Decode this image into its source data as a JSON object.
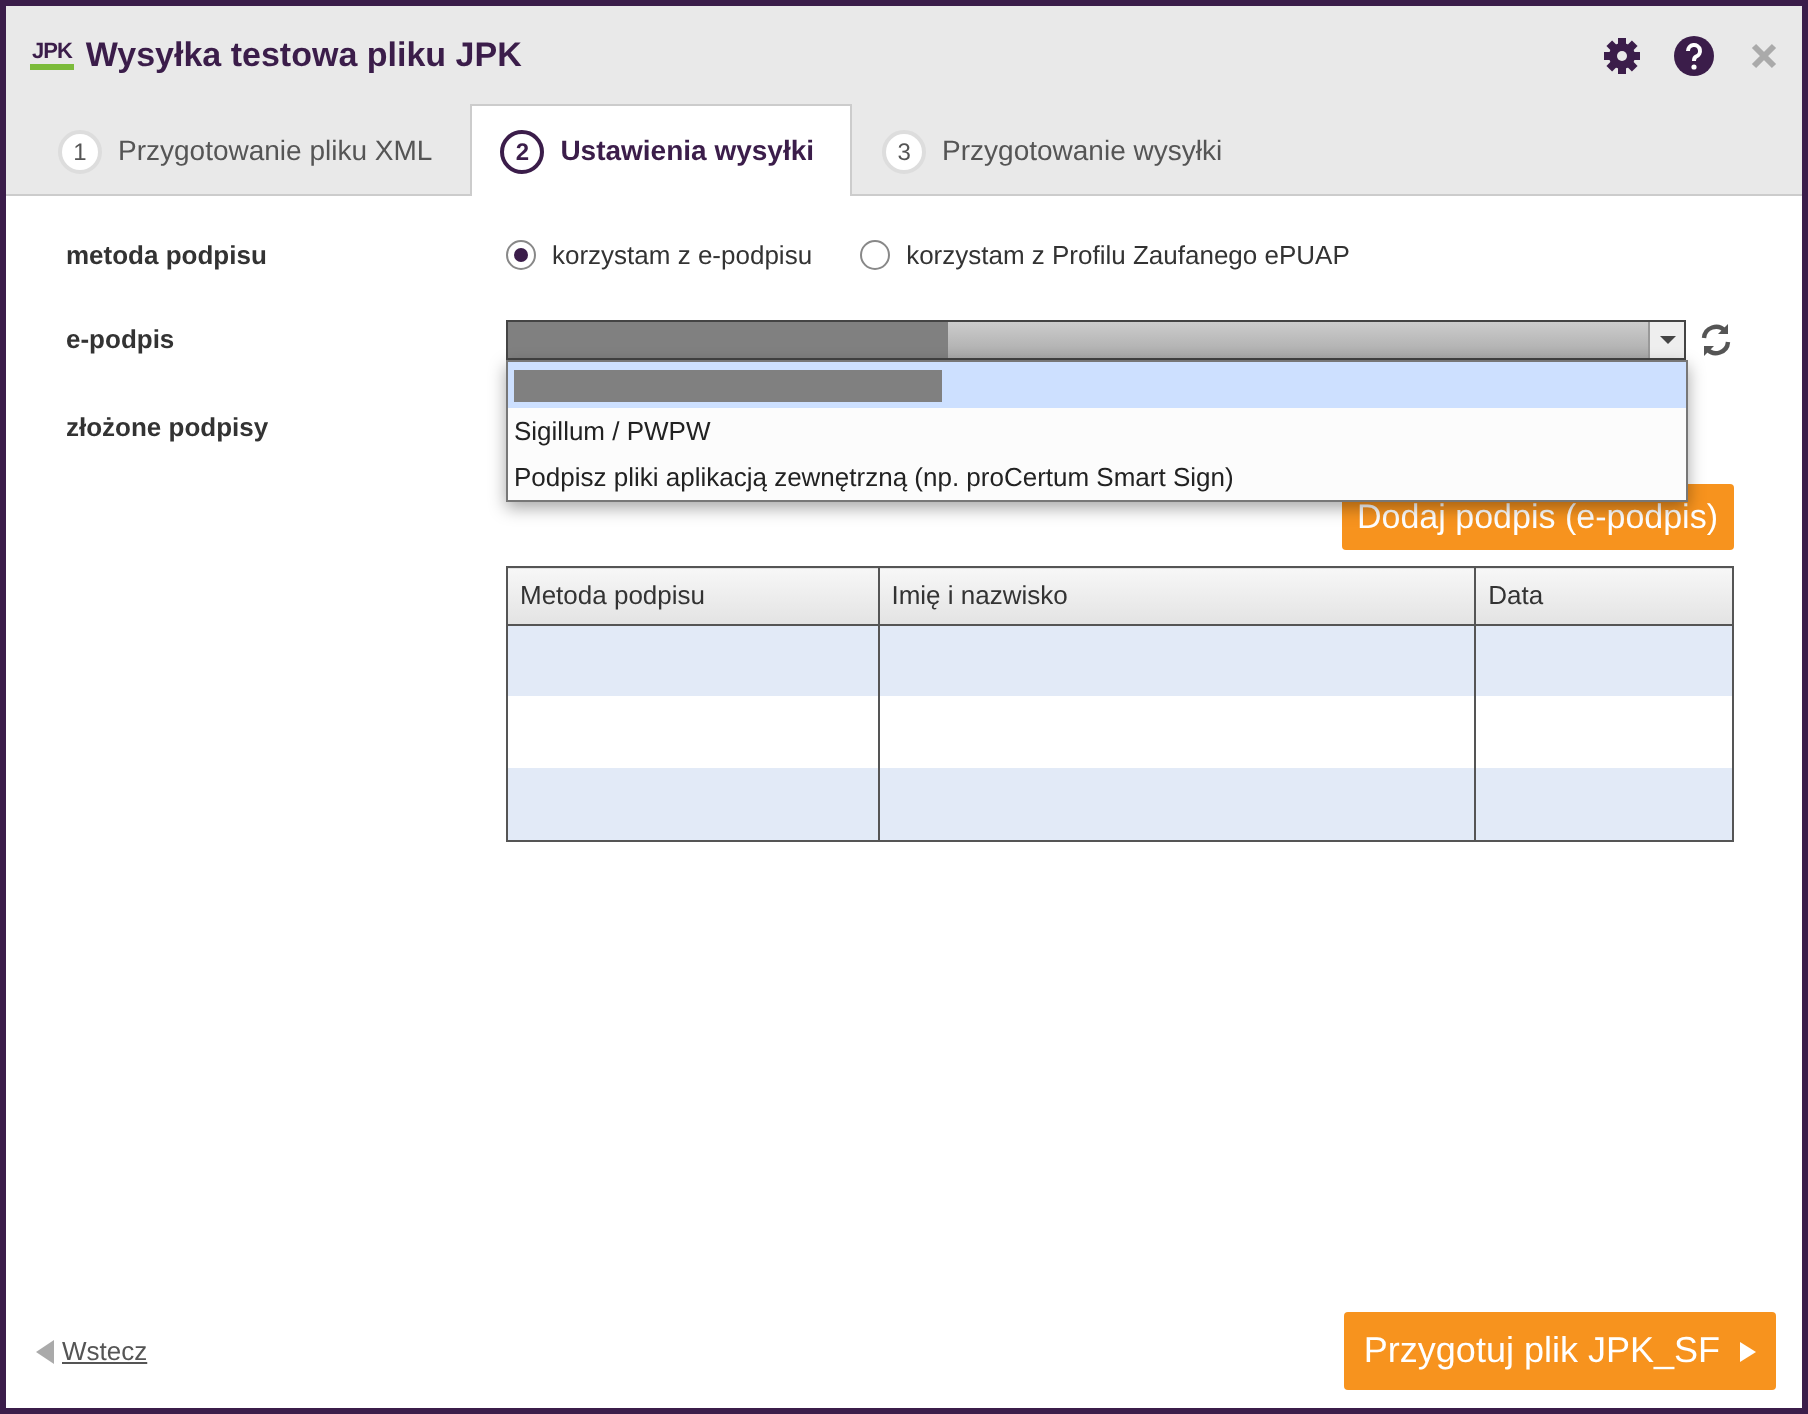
{
  "window": {
    "title": "Wysyłka testowa pliku JPK",
    "logo": "JPK"
  },
  "tabs": [
    {
      "number": "1",
      "label": "Przygotowanie pliku XML",
      "selected": false
    },
    {
      "number": "2",
      "label": "Ustawienia wysyłki",
      "selected": true
    },
    {
      "number": "3",
      "label": "Przygotowanie wysyłki",
      "selected": false
    }
  ],
  "form": {
    "signature_method": {
      "label": "metoda podpisu",
      "options": [
        {
          "label": "korzystam z e-podpisu",
          "selected": true
        },
        {
          "label": "korzystam z Profilu Zaufanego ePUAP",
          "selected": false
        }
      ]
    },
    "e_signature": {
      "label": "e-podpis",
      "value": {
        "kind": "redacted"
      },
      "expanded": true,
      "options": [
        {
          "kind": "redacted",
          "selected": true
        },
        {
          "kind": "text",
          "label": "Sigillum / PWPW",
          "selected": false
        },
        {
          "kind": "text",
          "label": "Podpisz pliki aplikacją zewnętrzną (np. proCertum Smart Sign)",
          "selected": false
        }
      ]
    },
    "signatures": {
      "label": "złożone podpisy",
      "add_button": "Dodaj podpis (e-podpis)",
      "table": {
        "columns": [
          "Metoda podpisu",
          "Imię i nazwisko",
          "Data"
        ],
        "rows": [
          {
            "striped": true
          },
          {
            "striped": false
          },
          {
            "striped": true
          }
        ]
      }
    }
  },
  "footer": {
    "back_link": "Wstecz",
    "next_button": "Przygotuj plik JPK_SF"
  }
}
